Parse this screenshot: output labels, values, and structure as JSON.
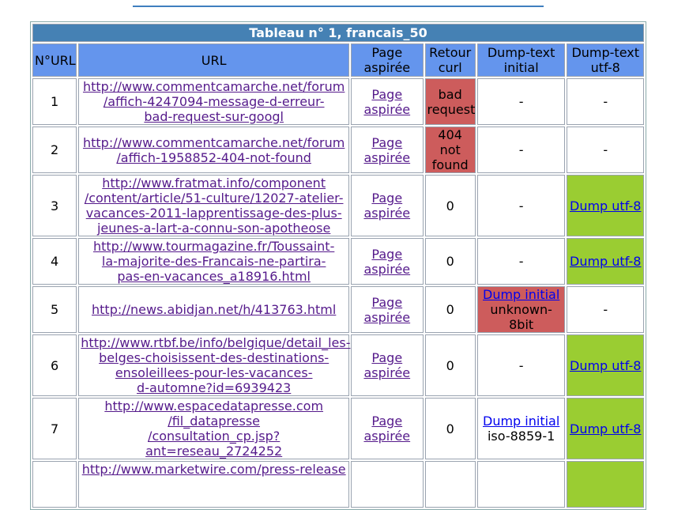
{
  "table": {
    "title": "Tableau n° 1, francais_50",
    "headers": [
      "N°URL",
      "URL",
      "Page aspirée",
      "Retour curl",
      "Dump-text initial",
      "Dump-text utf-8"
    ],
    "rows": [
      {
        "num": "1",
        "url": [
          "http://www.commentcamarche.net/forum",
          "/affich-4247094-message-d-erreur-",
          "bad-request-sur-googl"
        ],
        "page": [
          "Page",
          "aspirée"
        ],
        "curl": [
          "bad",
          "request"
        ],
        "dump_initial": "-",
        "dump_utf8": "-"
      },
      {
        "num": "2",
        "url": [
          "http://www.commentcamarche.net/forum",
          "/affich-1958852-404-not-found"
        ],
        "page": [
          "Page",
          "aspirée"
        ],
        "curl": [
          "404 not",
          "found"
        ],
        "dump_initial": "-",
        "dump_utf8": "-"
      },
      {
        "num": "3",
        "url": [
          "http://www.fratmat.info/component",
          "/content/article/51-culture/12027-atelier-",
          "vacances-2011-lapprentissage-des-plus-",
          "jeunes-a-lart-a-connu-son-apotheose"
        ],
        "page": [
          "Page",
          "aspirée"
        ],
        "curl": "0",
        "dump_initial": "-",
        "dump_utf8": "Dump utf-8"
      },
      {
        "num": "4",
        "url": [
          "http://www.tourmagazine.fr/Toussaint-",
          "la-majorite-des-Francais-ne-partira-",
          "pas-en-vacances_a18916.html"
        ],
        "page": [
          "Page",
          "aspirée"
        ],
        "curl": "0",
        "dump_initial": "-",
        "dump_utf8": "Dump utf-8"
      },
      {
        "num": "5",
        "url": [
          "http://news.abidjan.net/h/413763.html"
        ],
        "page": [
          "Page",
          "aspirée"
        ],
        "curl": "0",
        "dump_initial_link": "Dump initial",
        "dump_initial_enc": "unknown-8bit",
        "dump_utf8": "-"
      },
      {
        "num": "6",
        "url": [
          "http://www.rtbf.be/info/belgique/detail_les-",
          "belges-choisissent-des-destinations-",
          "ensoleillees-pour-les-vacances-",
          "d-automne?id=6939423"
        ],
        "page": [
          "Page",
          "aspirée"
        ],
        "curl": "0",
        "dump_initial": "-",
        "dump_utf8": "Dump utf-8"
      },
      {
        "num": "7",
        "url": [
          "http://www.espacedatapresse.com",
          "/fil_datapresse",
          "/consultation_cp.jsp?ant=reseau_2724252"
        ],
        "page": [
          "Page",
          "aspirée"
        ],
        "curl": "0",
        "dump_initial_link": "Dump initial",
        "dump_initial_enc": "iso-8859-1",
        "dump_utf8": "Dump utf-8"
      },
      {
        "num": "",
        "url": [
          "http://www.marketwire.com/press-release"
        ],
        "page": [
          "",
          ""
        ],
        "curl": "",
        "dump_initial": "",
        "dump_utf8": ""
      }
    ]
  },
  "colors": {
    "title_bg": "#4581b4",
    "header_bg": "#6495ed",
    "error_bg": "#cd5c5c",
    "success_bg": "#9acd32",
    "visited_link": "#551a8b",
    "link": "#0000ee"
  }
}
